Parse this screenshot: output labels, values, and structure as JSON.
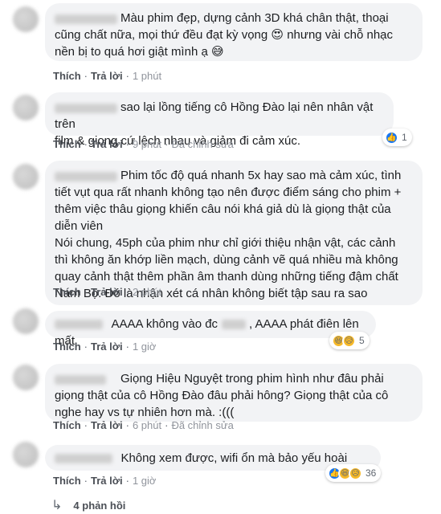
{
  "actions": {
    "like": "Thích",
    "reply": "Trả lời",
    "edited": "Đã chỉnh sửa"
  },
  "comments": [
    {
      "text": "Màu phim đẹp, dựng cảnh 3D khá chân thật, thoại\ncũng chất nữa, mọi thứ đều đạt kỳ vọng 😍 nhưng vài chỗ nhạc\nnền bị to quá hơi giật mình ạ 😅",
      "time": "1 phút"
    },
    {
      "text": "sao lại lồng tiếng cô Hồng Đào lại nên nhân vật trên\nfilm & giọng cứ lệch nhau và giảm đi cảm xúc.",
      "time": "9 phút",
      "reaction_count": "1"
    },
    {
      "text": "Phim tốc độ quá nhanh 5x hay sao mà cảm xúc, tình\ntiết vụt qua rất nhanh không tạo nên được điểm sáng cho phim +\nthêm việc thâu giọng khiến câu nói khá giả dù là giọng thật của\ndiễn viên\nNói chung, 45ph của phim như chỉ giới thiệu nhận vật, các cảnh\nthì không ăn khớp liền mạch, dùng cảnh vẽ quá nhiều mà không\nquay cảnh thật thêm phần âm thanh dùng những tiếng đậm chất\nNam Bộ. Đó là nhận xét cá nhân không biết tập sau ra sao",
      "time": "2 phút"
    },
    {
      "text_a": "AAAA không vào đc",
      "text_b": ", AAAA phát điên lên mất",
      "time": "1 giờ",
      "reaction_count": "5"
    },
    {
      "text": "Giọng Hiệu Nguyệt trong phim hình như đâu phải\ngiọng thật của cô Hồng Đào đâu phải hông? Giọng thật của cô\nnghe hay vs tự nhiên hơn mà. :(((",
      "time": "6 phút"
    },
    {
      "text": "Không xem được, wifi ổn mà bảo yếu hoài",
      "time": "1 giờ",
      "reaction_count": "36"
    }
  ],
  "more_replies": "4 phản hồi",
  "icons": {
    "reply_arrow": "reply-arrow-icon",
    "like": "like-icon",
    "haha": "haha-icon",
    "sad": "sad-icon"
  }
}
